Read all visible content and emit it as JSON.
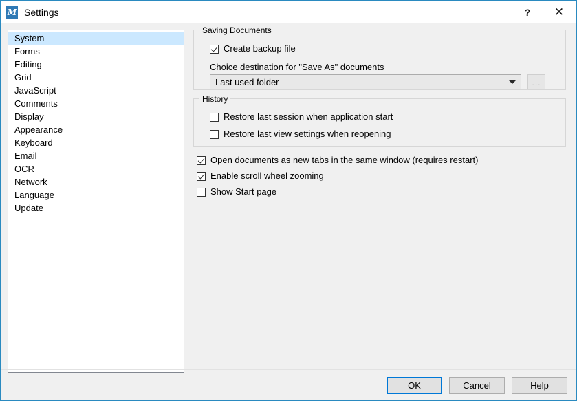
{
  "window": {
    "title": "Settings",
    "icon": "app-icon",
    "accent_color": "#0078d7",
    "border_color": "#2a8ac0",
    "background": "#f0f0f0",
    "help_button": "?",
    "close_button": "✕"
  },
  "sidebar": {
    "selected": "System",
    "items": [
      {
        "label": "System"
      },
      {
        "label": "Forms"
      },
      {
        "label": "Editing"
      },
      {
        "label": "Grid"
      },
      {
        "label": "JavaScript"
      },
      {
        "label": "Comments"
      },
      {
        "label": "Display"
      },
      {
        "label": "Appearance"
      },
      {
        "label": "Keyboard"
      },
      {
        "label": "Email"
      },
      {
        "label": "OCR"
      },
      {
        "label": "Network"
      },
      {
        "label": "Language"
      },
      {
        "label": "Update"
      }
    ]
  },
  "saving_documents": {
    "group_title": "Saving Documents",
    "create_backup": {
      "label": "Create backup file",
      "checked": true
    },
    "destination_label": "Choice destination for \"Save As\" documents",
    "destination_value": "Last used folder",
    "destination_options": [
      "Last used folder"
    ],
    "browse_button": "..."
  },
  "history": {
    "group_title": "History",
    "restore_session": {
      "label": "Restore last session when application start",
      "checked": false
    },
    "restore_view": {
      "label": "Restore last view settings when reopening",
      "checked": false
    }
  },
  "general_options": [
    {
      "label": "Open documents as new tabs in the same window (requires restart)",
      "checked": true
    },
    {
      "label": "Enable scroll wheel zooming",
      "checked": true
    },
    {
      "label": "Show Start page",
      "checked": false
    }
  ],
  "footer": {
    "ok": "OK",
    "cancel": "Cancel",
    "help": "Help"
  }
}
